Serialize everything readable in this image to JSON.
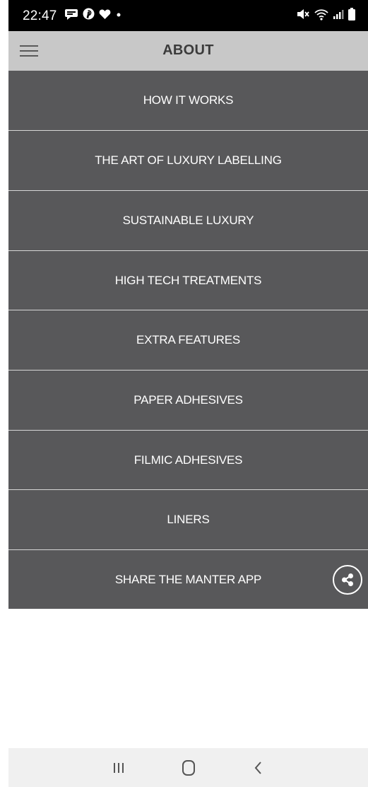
{
  "status_bar": {
    "time": "22:47",
    "left_icons": [
      "message-icon",
      "pinterest-icon",
      "heart-icon",
      "dot-icon"
    ],
    "right_icons": [
      "mute-icon",
      "wifi-icon",
      "signal-icon",
      "battery-icon"
    ]
  },
  "header": {
    "title": "ABOUT",
    "menu_icon": "hamburger-menu-icon"
  },
  "menu": {
    "items": [
      {
        "label": "HOW IT WORKS"
      },
      {
        "label": "THE ART OF LUXURY LABELLING"
      },
      {
        "label": "SUSTAINABLE LUXURY"
      },
      {
        "label": "HIGH TECH TREATMENTS"
      },
      {
        "label": "EXTRA FEATURES"
      },
      {
        "label": "PAPER ADHESIVES"
      },
      {
        "label": "FILMIC ADHESIVES"
      },
      {
        "label": "LINERS"
      },
      {
        "label": "SHARE THE MANTER APP",
        "icon": "share-icon"
      }
    ]
  },
  "nav_bar": {
    "buttons": [
      "recent-apps-icon",
      "home-icon",
      "back-icon"
    ]
  },
  "colors": {
    "status_bar_bg": "#000000",
    "header_bg": "#c8c8c8",
    "header_text": "#3b3b3b",
    "menu_bg": "#58585a",
    "menu_text": "#ffffff",
    "divider": "#d6d6d6",
    "nav_bar_bg": "#f0f0f0"
  }
}
